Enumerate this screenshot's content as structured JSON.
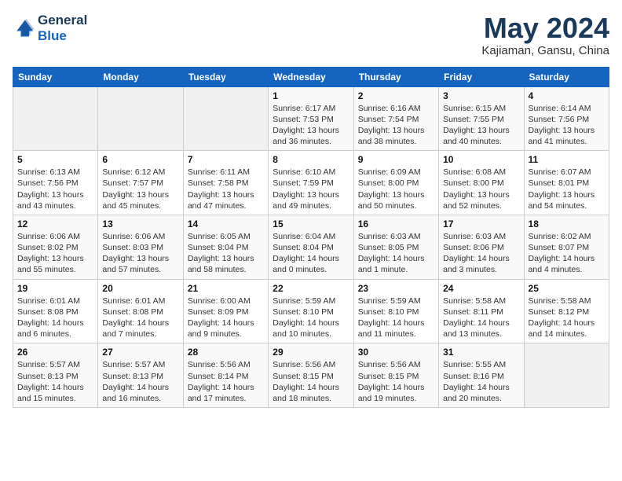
{
  "logo": {
    "line1": "General",
    "line2": "Blue"
  },
  "calendar": {
    "title": "May 2024",
    "subtitle": "Kajiaman, Gansu, China"
  },
  "weekdays": [
    "Sunday",
    "Monday",
    "Tuesday",
    "Wednesday",
    "Thursday",
    "Friday",
    "Saturday"
  ],
  "weeks": [
    [
      {
        "day": "",
        "info": ""
      },
      {
        "day": "",
        "info": ""
      },
      {
        "day": "",
        "info": ""
      },
      {
        "day": "1",
        "info": "Sunrise: 6:17 AM\nSunset: 7:53 PM\nDaylight: 13 hours\nand 36 minutes."
      },
      {
        "day": "2",
        "info": "Sunrise: 6:16 AM\nSunset: 7:54 PM\nDaylight: 13 hours\nand 38 minutes."
      },
      {
        "day": "3",
        "info": "Sunrise: 6:15 AM\nSunset: 7:55 PM\nDaylight: 13 hours\nand 40 minutes."
      },
      {
        "day": "4",
        "info": "Sunrise: 6:14 AM\nSunset: 7:56 PM\nDaylight: 13 hours\nand 41 minutes."
      }
    ],
    [
      {
        "day": "5",
        "info": "Sunrise: 6:13 AM\nSunset: 7:56 PM\nDaylight: 13 hours\nand 43 minutes."
      },
      {
        "day": "6",
        "info": "Sunrise: 6:12 AM\nSunset: 7:57 PM\nDaylight: 13 hours\nand 45 minutes."
      },
      {
        "day": "7",
        "info": "Sunrise: 6:11 AM\nSunset: 7:58 PM\nDaylight: 13 hours\nand 47 minutes."
      },
      {
        "day": "8",
        "info": "Sunrise: 6:10 AM\nSunset: 7:59 PM\nDaylight: 13 hours\nand 49 minutes."
      },
      {
        "day": "9",
        "info": "Sunrise: 6:09 AM\nSunset: 8:00 PM\nDaylight: 13 hours\nand 50 minutes."
      },
      {
        "day": "10",
        "info": "Sunrise: 6:08 AM\nSunset: 8:00 PM\nDaylight: 13 hours\nand 52 minutes."
      },
      {
        "day": "11",
        "info": "Sunrise: 6:07 AM\nSunset: 8:01 PM\nDaylight: 13 hours\nand 54 minutes."
      }
    ],
    [
      {
        "day": "12",
        "info": "Sunrise: 6:06 AM\nSunset: 8:02 PM\nDaylight: 13 hours\nand 55 minutes."
      },
      {
        "day": "13",
        "info": "Sunrise: 6:06 AM\nSunset: 8:03 PM\nDaylight: 13 hours\nand 57 minutes."
      },
      {
        "day": "14",
        "info": "Sunrise: 6:05 AM\nSunset: 8:04 PM\nDaylight: 13 hours\nand 58 minutes."
      },
      {
        "day": "15",
        "info": "Sunrise: 6:04 AM\nSunset: 8:04 PM\nDaylight: 14 hours\nand 0 minutes."
      },
      {
        "day": "16",
        "info": "Sunrise: 6:03 AM\nSunset: 8:05 PM\nDaylight: 14 hours\nand 1 minute."
      },
      {
        "day": "17",
        "info": "Sunrise: 6:03 AM\nSunset: 8:06 PM\nDaylight: 14 hours\nand 3 minutes."
      },
      {
        "day": "18",
        "info": "Sunrise: 6:02 AM\nSunset: 8:07 PM\nDaylight: 14 hours\nand 4 minutes."
      }
    ],
    [
      {
        "day": "19",
        "info": "Sunrise: 6:01 AM\nSunset: 8:08 PM\nDaylight: 14 hours\nand 6 minutes."
      },
      {
        "day": "20",
        "info": "Sunrise: 6:01 AM\nSunset: 8:08 PM\nDaylight: 14 hours\nand 7 minutes."
      },
      {
        "day": "21",
        "info": "Sunrise: 6:00 AM\nSunset: 8:09 PM\nDaylight: 14 hours\nand 9 minutes."
      },
      {
        "day": "22",
        "info": "Sunrise: 5:59 AM\nSunset: 8:10 PM\nDaylight: 14 hours\nand 10 minutes."
      },
      {
        "day": "23",
        "info": "Sunrise: 5:59 AM\nSunset: 8:10 PM\nDaylight: 14 hours\nand 11 minutes."
      },
      {
        "day": "24",
        "info": "Sunrise: 5:58 AM\nSunset: 8:11 PM\nDaylight: 14 hours\nand 13 minutes."
      },
      {
        "day": "25",
        "info": "Sunrise: 5:58 AM\nSunset: 8:12 PM\nDaylight: 14 hours\nand 14 minutes."
      }
    ],
    [
      {
        "day": "26",
        "info": "Sunrise: 5:57 AM\nSunset: 8:13 PM\nDaylight: 14 hours\nand 15 minutes."
      },
      {
        "day": "27",
        "info": "Sunrise: 5:57 AM\nSunset: 8:13 PM\nDaylight: 14 hours\nand 16 minutes."
      },
      {
        "day": "28",
        "info": "Sunrise: 5:56 AM\nSunset: 8:14 PM\nDaylight: 14 hours\nand 17 minutes."
      },
      {
        "day": "29",
        "info": "Sunrise: 5:56 AM\nSunset: 8:15 PM\nDaylight: 14 hours\nand 18 minutes."
      },
      {
        "day": "30",
        "info": "Sunrise: 5:56 AM\nSunset: 8:15 PM\nDaylight: 14 hours\nand 19 minutes."
      },
      {
        "day": "31",
        "info": "Sunrise: 5:55 AM\nSunset: 8:16 PM\nDaylight: 14 hours\nand 20 minutes."
      },
      {
        "day": "",
        "info": ""
      }
    ]
  ]
}
